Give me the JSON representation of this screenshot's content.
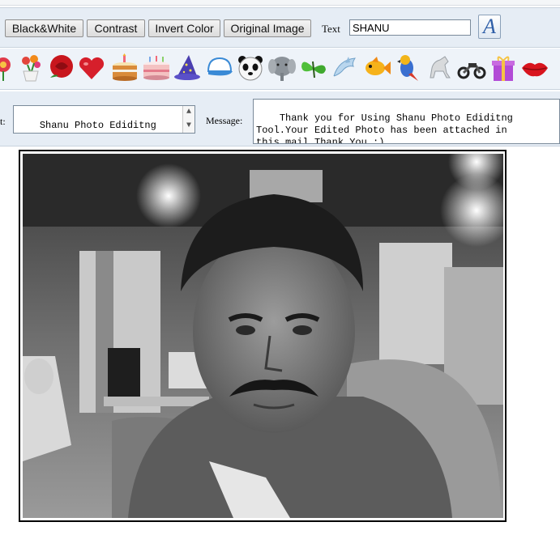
{
  "toolbar": {
    "buttons": [
      "Black&White",
      "Contrast",
      "Invert Color",
      "Original Image"
    ],
    "text_label": "Text",
    "text_value": "SHANU",
    "font_glyph": "A"
  },
  "stickers": [
    "flower-icon",
    "flower-pot-icon",
    "rose-icon",
    "heart-icon",
    "birthday-cake-icon",
    "cake-icon",
    "wizard-hat-icon",
    "cap-icon",
    "panda-icon",
    "elephant-icon",
    "butterfly-icon",
    "dolphin-icon",
    "fish-icon",
    "parrot-icon",
    "horse-icon",
    "motorbike-icon",
    "gift-box-icon",
    "lips-icon"
  ],
  "mail": {
    "subject_label": "t:",
    "subject_value": "Shanu Photo Ediditng\nTool Photo",
    "message_label": "Message:",
    "message_value": "Thank you for Using Shanu Photo Ediditng\nTool.Your Edited Photo has been attached in\nthis mail.Thank You :)"
  }
}
